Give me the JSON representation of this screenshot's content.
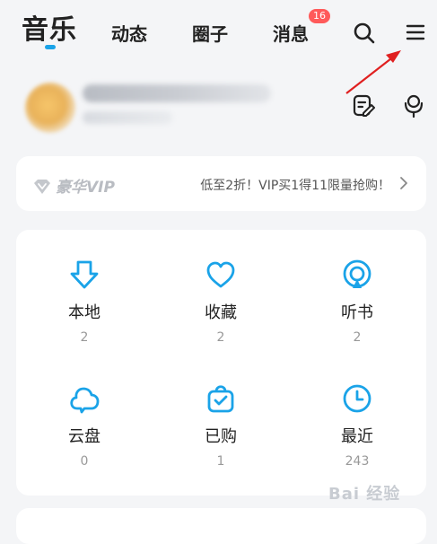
{
  "colors": {
    "accent": "#1aa3e8",
    "badge": "#ff5a5a",
    "annotation_arrow": "#e02020"
  },
  "header": {
    "tabs": [
      {
        "label": "音乐",
        "active": true
      },
      {
        "label": "动态"
      },
      {
        "label": "圈子"
      },
      {
        "label": "消息"
      }
    ],
    "messages_badge": "16",
    "icons": [
      "search-icon",
      "menu-icon"
    ]
  },
  "profile": {
    "icons": [
      "edit-note-icon",
      "microphone-icon"
    ]
  },
  "vip": {
    "logo_text": "豪华VIP",
    "promo": "低至2折！VIP买1得11限量抢购！",
    "icon": "diamond-icon"
  },
  "grid": {
    "items": [
      {
        "label": "本地",
        "count": "2",
        "icon": "download-icon"
      },
      {
        "label": "收藏",
        "count": "2",
        "icon": "heart-icon"
      },
      {
        "label": "听书",
        "count": "2",
        "icon": "podcast-icon"
      },
      {
        "label": "云盘",
        "count": "0",
        "icon": "cloud-icon"
      },
      {
        "label": "已购",
        "count": "1",
        "icon": "bag-check-icon"
      },
      {
        "label": "最近",
        "count": "243",
        "icon": "clock-icon"
      }
    ]
  },
  "watermark": "Bai 经验"
}
